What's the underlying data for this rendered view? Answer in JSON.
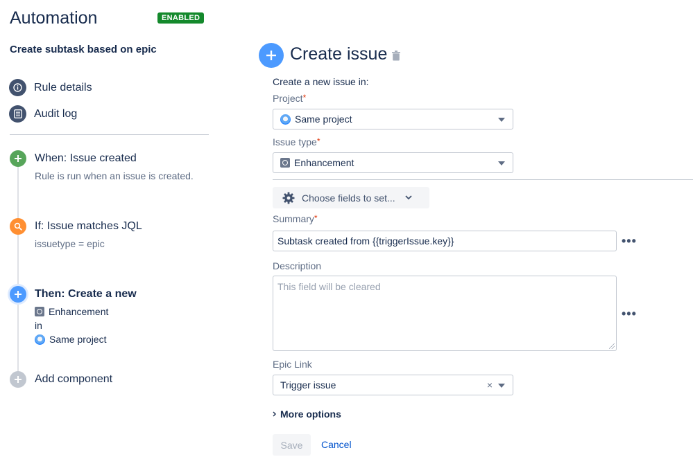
{
  "app": {
    "title": "Automation",
    "status_badge": "ENABLED"
  },
  "rule": {
    "name": "Create subtask based on epic"
  },
  "nav": {
    "items": [
      {
        "label": "Rule details",
        "icon": "info-icon"
      },
      {
        "label": "Audit log",
        "icon": "list-icon"
      }
    ]
  },
  "steps": {
    "trigger": {
      "title": "When: Issue created",
      "subtitle": "Rule is run when an issue is created.",
      "color": "#57a55a"
    },
    "condition": {
      "title": "If: Issue matches JQL",
      "subtitle": "issuetype = epic",
      "color": "#ff8f32"
    },
    "action": {
      "title": "Then: Create a new",
      "issue_type": "Enhancement",
      "in_word": "in",
      "project": "Same project",
      "color": "#4c9aff"
    },
    "add": {
      "title": "Add component",
      "color": "#c1c7d0"
    }
  },
  "editor": {
    "title": "Create issue",
    "intro": "Create a new issue in:",
    "required_mark": "*",
    "project": {
      "label": "Project",
      "value": "Same project"
    },
    "issue_type": {
      "label": "Issue type",
      "value": "Enhancement"
    },
    "choose_fields": "Choose fields to set...",
    "summary": {
      "label": "Summary",
      "value": "Subtask created from {{triggerIssue.key}}"
    },
    "description": {
      "label": "Description",
      "placeholder": "This field will be cleared"
    },
    "epic_link": {
      "label": "Epic Link",
      "value": "Trigger issue",
      "clear": "×"
    },
    "more_options": "More options",
    "save": "Save",
    "cancel": "Cancel",
    "dots": "•••"
  }
}
